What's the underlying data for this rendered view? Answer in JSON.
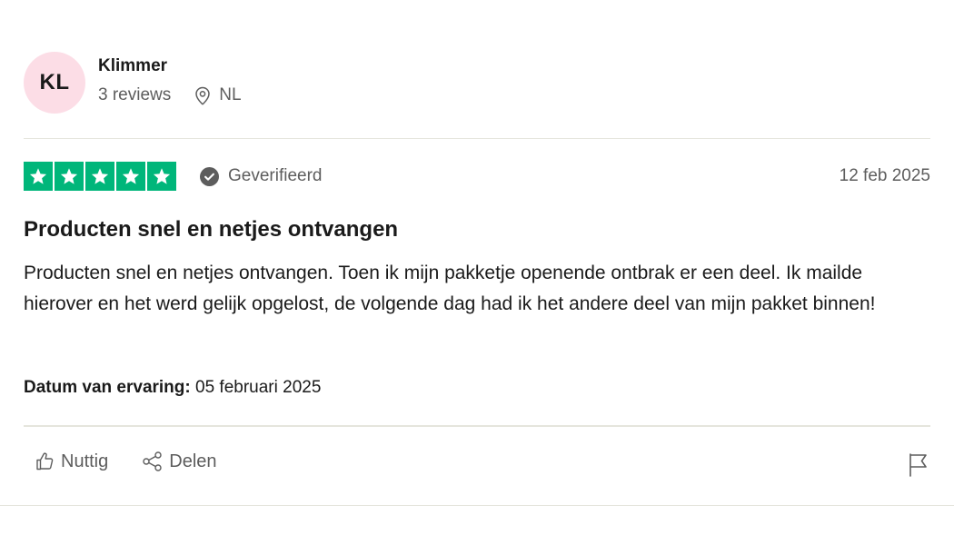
{
  "reviewer": {
    "initials": "KL",
    "name": "Klimmer",
    "reviews_count": "3 reviews",
    "country": "NL",
    "avatar_color": "#fcdde6"
  },
  "review": {
    "rating": 5,
    "star_color": "#00b67a",
    "verified_label": "Geverifieerd",
    "date": "12 feb 2025",
    "title": "Producten snel en netjes ontvangen",
    "body": "Producten snel en netjes ontvangen. Toen ik mijn pakketje openende ontbrak er een deel. Ik mailde hierover en het werd gelijk opgelost, de volgende dag had ik het andere deel van mijn pakket binnen!",
    "experience_label": "Datum van ervaring:",
    "experience_date": "05 februari 2025"
  },
  "actions": {
    "useful_label": "Nuttig",
    "share_label": "Delen",
    "useful_icon": "thumbs-up-icon",
    "share_icon": "share-icon",
    "report_icon": "flag-icon"
  }
}
